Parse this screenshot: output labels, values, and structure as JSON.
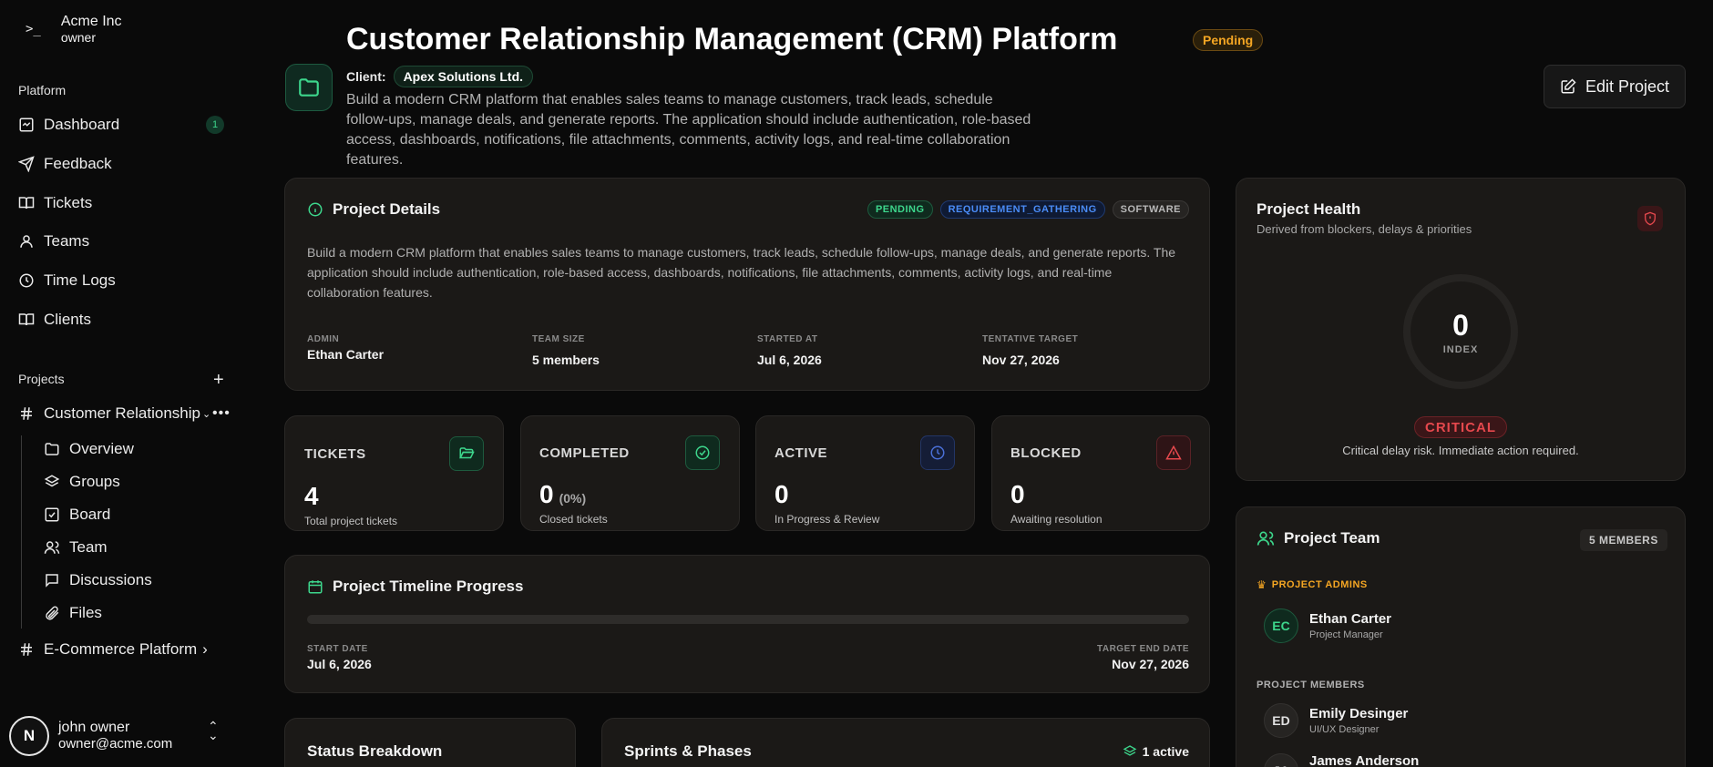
{
  "sidebar": {
    "org_name": "Acme Inc",
    "org_role": "owner",
    "platform_label": "Platform",
    "nav": [
      {
        "label": "Dashboard",
        "badge": "1"
      },
      {
        "label": "Feedback"
      },
      {
        "label": "Tickets"
      },
      {
        "label": "Teams"
      },
      {
        "label": "Time Logs"
      },
      {
        "label": "Clients"
      }
    ],
    "projects_label": "Projects",
    "projects": [
      {
        "label": "Customer Relationship",
        "sub": [
          "Overview",
          "Groups",
          "Board",
          "Team",
          "Discussions",
          "Files"
        ]
      },
      {
        "label": "E-Commerce Platform"
      }
    ],
    "user": {
      "initial": "N",
      "name": "john owner",
      "email": "owner@acme.com"
    }
  },
  "header": {
    "title": "Customer Relationship Management (CRM) Platform",
    "status": "Pending",
    "client_label": "Client:",
    "client_name": "Apex Solutions Ltd.",
    "description": "Build a modern CRM platform that enables sales teams to manage customers, track leads, schedule follow-ups, manage deals, and generate reports. The application should include authentication, role-based access, dashboards, notifications, file attachments, comments, activity logs, and real-time collaboration features.",
    "edit_label": "Edit Project"
  },
  "details": {
    "title": "Project Details",
    "tags": [
      "PENDING",
      "REQUIREMENT_GATHERING",
      "SOFTWARE"
    ],
    "description": "Build a modern CRM platform that enables sales teams to manage customers, track leads, schedule follow-ups, manage deals, and generate reports. The application should include authentication, role-based access, dashboards, notifications, file attachments, comments, activity logs, and real-time collaboration features.",
    "meta": [
      {
        "label": "ADMIN",
        "value": "Ethan Carter"
      },
      {
        "label": "TEAM SIZE",
        "value": "5 members"
      },
      {
        "label": "STARTED AT",
        "value": "Jul 6, 2026"
      },
      {
        "label": "TENTATIVE TARGET",
        "value": "Nov 27, 2026"
      }
    ]
  },
  "stats": [
    {
      "title": "TICKETS",
      "value": "4",
      "extra": "",
      "sub": "Total project tickets",
      "color": "#3dd68c"
    },
    {
      "title": "COMPLETED",
      "value": "0",
      "extra": "(0%)",
      "sub": "Closed tickets",
      "color": "#3dd68c"
    },
    {
      "title": "ACTIVE",
      "value": "0",
      "extra": "",
      "sub": "In Progress & Review",
      "color": "#4a6fd6"
    },
    {
      "title": "BLOCKED",
      "value": "0",
      "extra": "",
      "sub": "Awaiting resolution",
      "color": "#e5484d"
    }
  ],
  "timeline": {
    "title": "Project Timeline Progress",
    "progress": 0,
    "start_label": "START DATE",
    "start_value": "Jul 6, 2026",
    "end_label": "TARGET END DATE",
    "end_value": "Nov 27, 2026"
  },
  "health": {
    "title": "Project Health",
    "subtitle": "Derived from blockers, delays & priorities",
    "index_value": "0",
    "index_label": "INDEX",
    "level": "CRITICAL",
    "message": "Critical delay risk. Immediate action required."
  },
  "team": {
    "title": "Project Team",
    "count": "5 MEMBERS",
    "admins_label": "PROJECT ADMINS",
    "admins": [
      {
        "initials": "EC",
        "name": "Ethan Carter",
        "role": "Project Manager"
      }
    ],
    "members_label": "PROJECT MEMBERS",
    "members": [
      {
        "initials": "ED",
        "name": "Emily Desinger",
        "role": "UI/UX Designer"
      },
      {
        "initials": "JA",
        "name": "James Anderson",
        "role": ""
      }
    ]
  },
  "bottom": {
    "status_title": "Status Breakdown",
    "sprints_title": "Sprints & Phases",
    "sprints_active": "1 active"
  },
  "colors": {
    "accent": "#3dd68c",
    "warning": "#f5a623",
    "danger": "#e5484d",
    "info": "#4a8cf7"
  }
}
